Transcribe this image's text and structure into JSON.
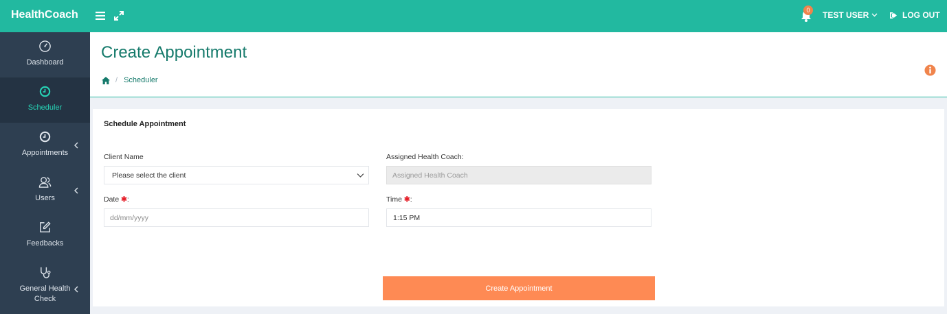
{
  "topbar": {
    "brand": "HealthCoach",
    "notification_count": "0",
    "user_name": "TEST USER",
    "logout_label": "LOG OUT",
    "background": "#22b9a0"
  },
  "sidebar": {
    "items": [
      {
        "label": "Dashboard",
        "icon": "speedometer-icon",
        "active": false,
        "has_submenu": false
      },
      {
        "label": "Scheduler",
        "icon": "clock-icon",
        "active": true,
        "has_submenu": false
      },
      {
        "label": "Appointments",
        "icon": "clock-icon",
        "active": false,
        "has_submenu": true
      },
      {
        "label": "Users",
        "icon": "users-icon",
        "active": false,
        "has_submenu": true
      },
      {
        "label": "Feedbacks",
        "icon": "edit-icon",
        "active": false,
        "has_submenu": false
      },
      {
        "label": "General Health Check",
        "icon": "stethoscope-icon",
        "active": false,
        "has_submenu": true
      }
    ]
  },
  "header": {
    "title": "Create Appointment",
    "breadcrumb": [
      "Scheduler"
    ]
  },
  "form": {
    "title": "Schedule Appointment",
    "client_label": "Client Name",
    "client_placeholder": "Please select the client",
    "coach_label": "Assigned Health Coach:",
    "coach_placeholder": "Assigned Health Coach",
    "date_label": "Date",
    "date_placeholder": "dd/mm/yyyy",
    "time_label": "Time",
    "time_value": "1:15 PM",
    "required_mark": "✱",
    "colon": ":",
    "submit_label": "Create Appointment"
  },
  "colors": {
    "accent": "#22b9a0",
    "sidebar": "#2e3f51",
    "button": "#fe8a54"
  }
}
